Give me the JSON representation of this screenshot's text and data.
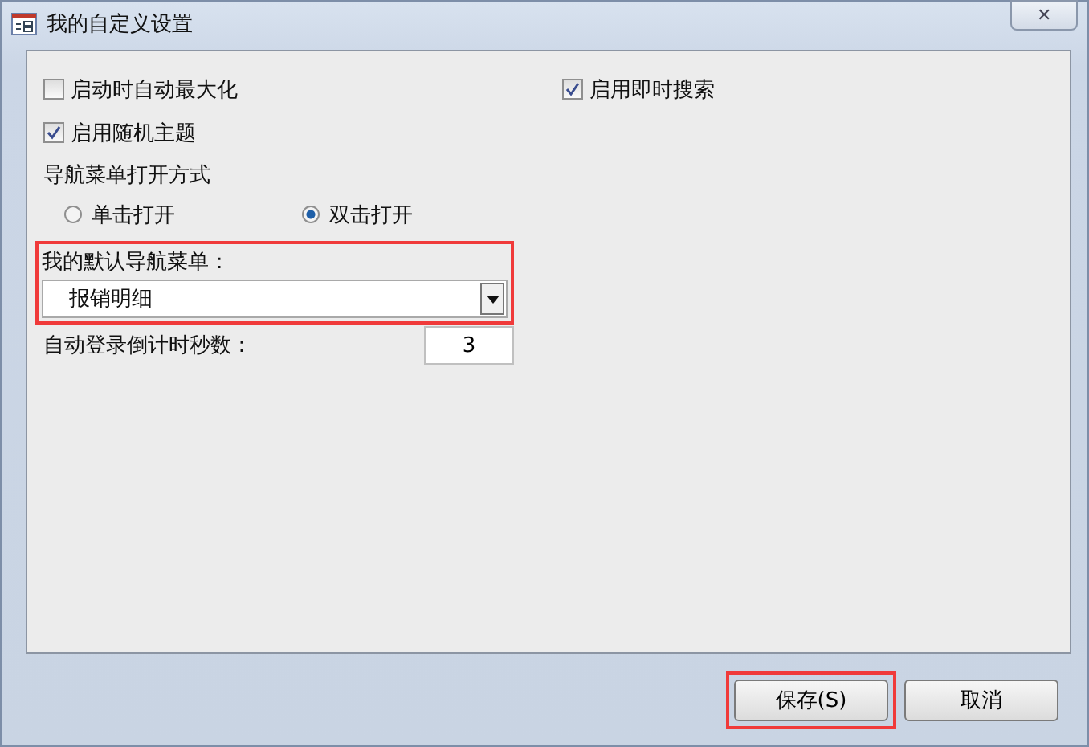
{
  "window": {
    "title": "我的自定义设置",
    "close": "✕"
  },
  "checkboxes": [
    {
      "label": "启动时自动最大化",
      "checked": false
    },
    {
      "label": "启用即时搜索",
      "checked": true
    },
    {
      "label": "启用随机主题",
      "checked": true
    }
  ],
  "open_mode": {
    "label": "导航菜单打开方式",
    "options": [
      {
        "label": "单击打开",
        "selected": false
      },
      {
        "label": "双击打开",
        "selected": true
      }
    ]
  },
  "default_menu": {
    "label": "我的默认导航菜单：",
    "value": "报销明细",
    "highlighted": true
  },
  "countdown": {
    "label": "自动登录倒计时秒数：",
    "value": "3"
  },
  "buttons": [
    {
      "label": "保存(S)",
      "highlighted": true
    },
    {
      "label": "取消",
      "highlighted": false
    }
  ]
}
